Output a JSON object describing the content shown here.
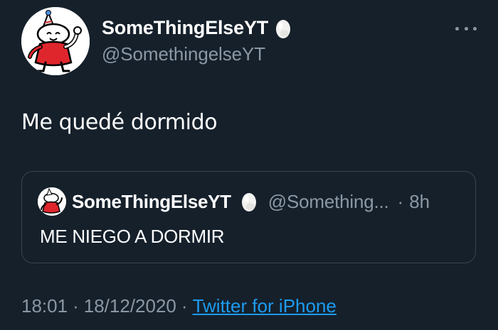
{
  "author": {
    "display_name": "SomeThingElseYT",
    "handle": "@SomethingelseYT",
    "avatar_icon": "cartoon-character-avatar",
    "badge_icon": "egg-icon"
  },
  "tweet": {
    "text": "Me quedé dormido",
    "time": "18:01",
    "separator_1": "·",
    "date": "18/12/2020",
    "separator_2": "·",
    "source": "Twitter for iPhone"
  },
  "quoted_tweet": {
    "display_name": "SomeThingElseYT",
    "handle": "@Something...",
    "separator": "·",
    "age": "8h",
    "text": "ME NIEGO A DORMIR"
  },
  "colors": {
    "background": "#15202b",
    "primary_text": "#ffffff",
    "secondary_text": "#8b98a5",
    "link": "#1d9bf0",
    "border": "#38444d"
  }
}
